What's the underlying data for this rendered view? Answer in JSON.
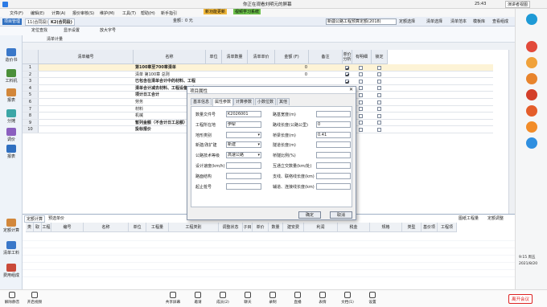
{
  "topbar": {
    "title": "你正在观看刘明元的屏幕",
    "time": "25:43",
    "viewer": "演讲者视图"
  },
  "menu": {
    "items": [
      "文件(F)",
      "编辑(E)",
      "计算(A)",
      "报价审核(S)",
      "维护(M)",
      "工具(T)",
      "帮助(H)"
    ],
    "guide": "新手指引",
    "qty_label": "0",
    "ok": "确定",
    "price_label": "金额：0 元",
    "summary_label": "清单：0 元",
    "btn_new": "新功能更新",
    "btn_learn": "视频学习系统"
  },
  "toolbar": {
    "project_tab": "项目管理",
    "tab2": "11(合同段)",
    "tab3": "K2(合同段)",
    "find": "定位查找",
    "show": "显示设置",
    "font": "放大字号",
    "standard": "新疆公路工程预算定额(2018)",
    "list_select": "定额选择",
    "list_template": "清单选择",
    "list_sample": "清单范本",
    "template_lib": "模板库",
    "view_combine": "查看组成"
  },
  "toolbar2": {
    "list_calc": "清单计量"
  },
  "grid": {
    "headers": [
      "清单编号",
      "名称",
      "单位",
      "清单数量",
      "清单单价",
      "金额 (F)",
      "备注",
      "单价分析",
      "有明细",
      "锁定"
    ],
    "rows": [
      {
        "n": "1",
        "code": "",
        "name": "第100章至700章清单",
        "amt": "0",
        "bold": true,
        "c1": true,
        "c2": false
      },
      {
        "n": "2",
        "code": "",
        "name": "清单 第100章 总则",
        "amt": "0",
        "bold": false,
        "c1": true,
        "c2": false
      },
      {
        "n": "3",
        "code": "",
        "name": "已包含在清单合计中的材料、工程",
        "amt": "",
        "bold": true,
        "c1": true,
        "c2": false
      },
      {
        "n": "4",
        "code": "",
        "name": "清单合计减去材料、工程设备、专",
        "amt": "",
        "bold": true,
        "c1": true,
        "c2": false
      },
      {
        "n": "5",
        "code": "",
        "name": "项计日工合计",
        "amt": "",
        "bold": true,
        "c1": false,
        "c2": false
      },
      {
        "n": "6",
        "code": "",
        "name": "劳务",
        "amt": "",
        "bold": false,
        "c1": false,
        "c2": false
      },
      {
        "n": "7",
        "code": "",
        "name": "材料",
        "amt": "",
        "bold": false,
        "c1": false,
        "c2": false
      },
      {
        "n": "8",
        "code": "",
        "name": "机械",
        "amt": "",
        "bold": false,
        "c1": false,
        "c2": false
      },
      {
        "n": "9",
        "code": "",
        "name": "暂列金额（不含计日工总额）",
        "amt": "",
        "bold": true,
        "c1": false,
        "c2": false
      },
      {
        "n": "10",
        "code": "",
        "name": "投标报价",
        "amt": "",
        "bold": true,
        "c1": false,
        "c2": false
      }
    ]
  },
  "sidebar": {
    "items": [
      "造价书",
      "工料机",
      "报表",
      "分摊",
      "调价",
      "报表"
    ],
    "lower": [
      "定额计算",
      "清单工料",
      "费用组成"
    ]
  },
  "dialog": {
    "title": "项目属性",
    "tabs": [
      "基本信息",
      "属性参数",
      "计算参数",
      "小数位数",
      "其他"
    ],
    "left_labels": [
      "数量文件号",
      "工程所在地",
      "地形类别",
      "新建/改扩建",
      "公路技术等级",
      "设计速度(km/h)",
      "路面结构",
      "起止桩号"
    ],
    "left_values": [
      "K2026001",
      "伊犁",
      "",
      "新建",
      "高速公路",
      "",
      "",
      ""
    ],
    "right_labels": [
      "路基宽度(m)",
      "路线长度(公路公里)",
      "桥梁长度(m)",
      "隧道长度(m)",
      "桥隧比例(%)",
      "互通立交数量(km/处)",
      "支线、联络线长度(km)",
      "辅道、连接线长度(km)"
    ],
    "right_values": [
      "",
      "0",
      "0.41",
      "",
      "",
      "",
      "",
      ""
    ],
    "ok": "确定",
    "cancel": "取消"
  },
  "lower": {
    "tabs": [
      "定额计算",
      "预选单价"
    ],
    "right_btns": [
      "图纸工程量",
      "定额调整"
    ],
    "headers": [
      "类型",
      "取费",
      "工程量单价",
      "编号",
      "名称",
      "单位",
      "工程量",
      "工程类别",
      "调整状态",
      "子目单价",
      "单价",
      "数量",
      "建安费",
      "利润",
      "税金",
      "规格",
      "类型",
      "基价项",
      "工程项"
    ]
  },
  "meeting": {
    "left": [
      "解除静音",
      "开启视频"
    ],
    "center": [
      "共享屏幕",
      "邀请",
      "成员(2)",
      "聊天",
      "录制",
      "直播",
      "表情",
      "文档(1)",
      "设置"
    ],
    "leave": "离开会议"
  },
  "clock": {
    "time": "9:15 周五",
    "date": "2021/8/20"
  }
}
